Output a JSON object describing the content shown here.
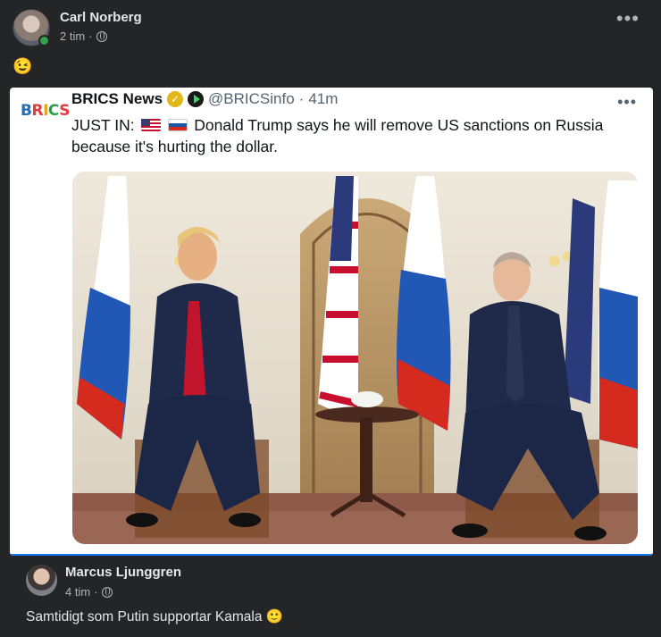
{
  "post": {
    "author": "Carl Norberg",
    "time": "2 tim",
    "separator": "·",
    "more": "•••",
    "text": "😉"
  },
  "tweet": {
    "logo_letters": [
      "B",
      "R",
      "I",
      "C",
      "S"
    ],
    "name": "BRICS News",
    "verified": "✓",
    "handle": "@BRICSinfo",
    "dot": "·",
    "time": "41m",
    "more": "•••",
    "text_lead": "JUST IN:",
    "text_body": "Donald Trump says he will remove US sanctions on Russia because it's hurting the dollar."
  },
  "reply": {
    "author": "Marcus Ljunggren",
    "time": "4 tim",
    "separator": "·",
    "text": "Samtidigt som Putin supportar Kamala 🙂"
  },
  "colors": {
    "background": "#242526",
    "online": "#31a24c",
    "accent": "#1877f2"
  }
}
